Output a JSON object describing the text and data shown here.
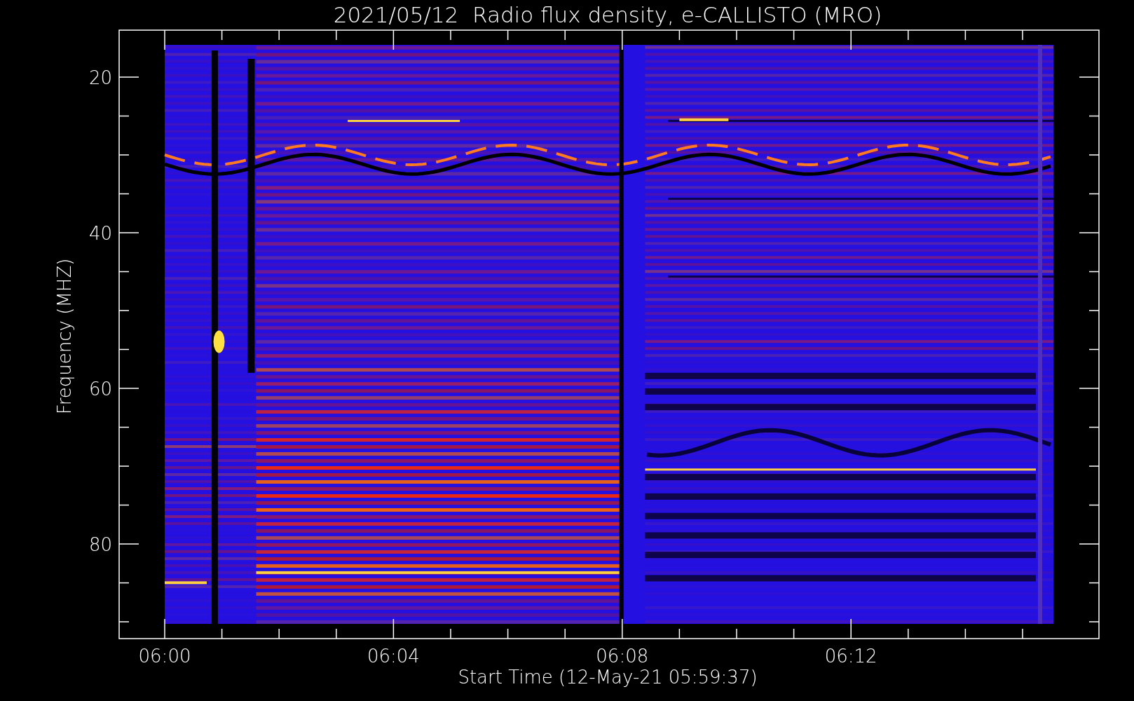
{
  "title": "2021/05/12  Radio flux density, e-CALLISTO (MRO)",
  "ylabel": "Frequency (MHZ)",
  "xlabel": "Start Time (12-May-21 05:59:37)",
  "yticks": [
    "20",
    "40",
    "60",
    "80"
  ],
  "xticks": [
    "06:00",
    "06:04",
    "06:08",
    "06:12"
  ]
}
